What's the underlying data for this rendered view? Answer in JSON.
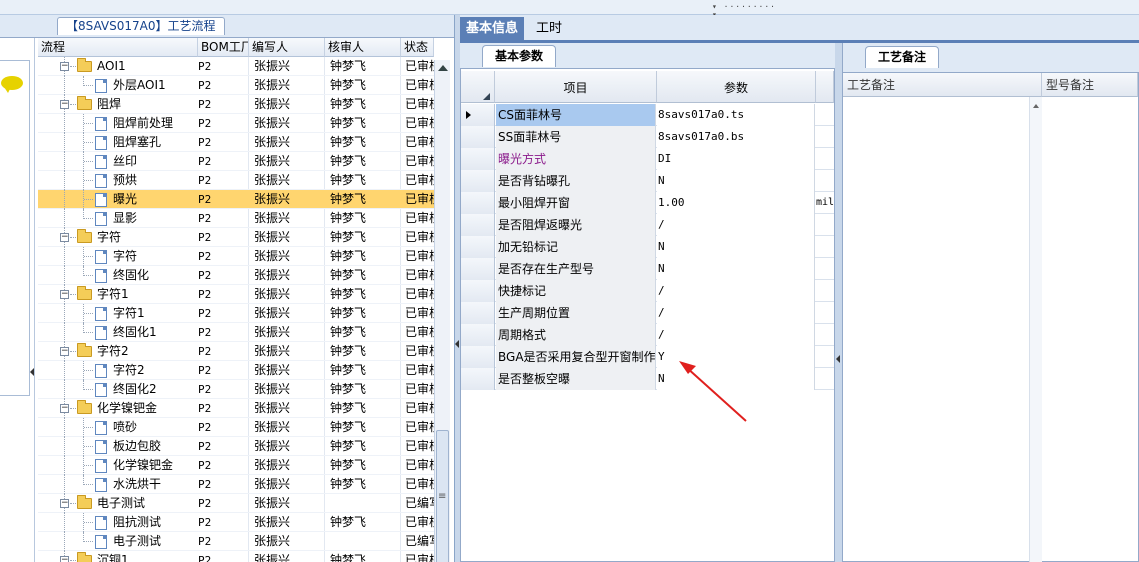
{
  "header_grip": "▾ ········· ▾",
  "left_panel": {
    "tab_title": "【8SAVS017A0】工艺流程",
    "columns": [
      "流程",
      "BOM工厂",
      "编写人",
      "核审人",
      "状态"
    ],
    "rows": [
      {
        "level": 1,
        "type": "folder",
        "name": "AOI1",
        "bom": "P2",
        "writer": "张振兴",
        "reviewer": "钟梦飞",
        "status": "已审核"
      },
      {
        "level": 2,
        "type": "doc",
        "name": "外层AOI1",
        "bom": "P2",
        "writer": "张振兴",
        "reviewer": "钟梦飞",
        "status": "已审核"
      },
      {
        "level": 1,
        "type": "folder",
        "name": "阻焊",
        "bom": "P2",
        "writer": "张振兴",
        "reviewer": "钟梦飞",
        "status": "已审核"
      },
      {
        "level": 2,
        "type": "doc",
        "name": "阻焊前处理",
        "bom": "P2",
        "writer": "张振兴",
        "reviewer": "钟梦飞",
        "status": "已审核"
      },
      {
        "level": 2,
        "type": "doc",
        "name": "阻焊塞孔",
        "bom": "P2",
        "writer": "张振兴",
        "reviewer": "钟梦飞",
        "status": "已审核"
      },
      {
        "level": 2,
        "type": "doc",
        "name": "丝印",
        "bom": "P2",
        "writer": "张振兴",
        "reviewer": "钟梦飞",
        "status": "已审核"
      },
      {
        "level": 2,
        "type": "doc",
        "name": "预烘",
        "bom": "P2",
        "writer": "张振兴",
        "reviewer": "钟梦飞",
        "status": "已审核"
      },
      {
        "level": 2,
        "type": "doc",
        "name": "曝光",
        "bom": "P2",
        "writer": "张振兴",
        "reviewer": "钟梦飞",
        "status": "已审核",
        "selected": true
      },
      {
        "level": 2,
        "type": "doc",
        "name": "显影",
        "bom": "P2",
        "writer": "张振兴",
        "reviewer": "钟梦飞",
        "status": "已审核"
      },
      {
        "level": 1,
        "type": "folder",
        "name": "字符",
        "bom": "P2",
        "writer": "张振兴",
        "reviewer": "钟梦飞",
        "status": "已审核"
      },
      {
        "level": 2,
        "type": "doc",
        "name": "字符",
        "bom": "P2",
        "writer": "张振兴",
        "reviewer": "钟梦飞",
        "status": "已审核"
      },
      {
        "level": 2,
        "type": "doc",
        "name": "终固化",
        "bom": "P2",
        "writer": "张振兴",
        "reviewer": "钟梦飞",
        "status": "已审核"
      },
      {
        "level": 1,
        "type": "folder",
        "name": "字符1",
        "bom": "P2",
        "writer": "张振兴",
        "reviewer": "钟梦飞",
        "status": "已审核"
      },
      {
        "level": 2,
        "type": "doc",
        "name": "字符1",
        "bom": "P2",
        "writer": "张振兴",
        "reviewer": "钟梦飞",
        "status": "已审核"
      },
      {
        "level": 2,
        "type": "doc",
        "name": "终固化1",
        "bom": "P2",
        "writer": "张振兴",
        "reviewer": "钟梦飞",
        "status": "已审核"
      },
      {
        "level": 1,
        "type": "folder",
        "name": "字符2",
        "bom": "P2",
        "writer": "张振兴",
        "reviewer": "钟梦飞",
        "status": "已审核"
      },
      {
        "level": 2,
        "type": "doc",
        "name": "字符2",
        "bom": "P2",
        "writer": "张振兴",
        "reviewer": "钟梦飞",
        "status": "已审核"
      },
      {
        "level": 2,
        "type": "doc",
        "name": "终固化2",
        "bom": "P2",
        "writer": "张振兴",
        "reviewer": "钟梦飞",
        "status": "已审核"
      },
      {
        "level": 1,
        "type": "folder",
        "name": "化学镍钯金",
        "bom": "P2",
        "writer": "张振兴",
        "reviewer": "钟梦飞",
        "status": "已审核"
      },
      {
        "level": 2,
        "type": "doc",
        "name": "喷砂",
        "bom": "P2",
        "writer": "张振兴",
        "reviewer": "钟梦飞",
        "status": "已审核"
      },
      {
        "level": 2,
        "type": "doc",
        "name": "板边包胶",
        "bom": "P2",
        "writer": "张振兴",
        "reviewer": "钟梦飞",
        "status": "已审核"
      },
      {
        "level": 2,
        "type": "doc",
        "name": "化学镍钯金",
        "bom": "P2",
        "writer": "张振兴",
        "reviewer": "钟梦飞",
        "status": "已审核"
      },
      {
        "level": 2,
        "type": "doc",
        "name": "水洗烘干",
        "bom": "P2",
        "writer": "张振兴",
        "reviewer": "钟梦飞",
        "status": "已审核"
      },
      {
        "level": 1,
        "type": "folder",
        "name": "电子测试",
        "bom": "P2",
        "writer": "张振兴",
        "reviewer": "",
        "status": "已编写"
      },
      {
        "level": 2,
        "type": "doc",
        "name": "阻抗测试",
        "bom": "P2",
        "writer": "张振兴",
        "reviewer": "钟梦飞",
        "status": "已审核"
      },
      {
        "level": 2,
        "type": "doc",
        "name": "电子测试",
        "bom": "P2",
        "writer": "张振兴",
        "reviewer": "",
        "status": "已编写"
      },
      {
        "level": 1,
        "type": "folder",
        "name": "沉铜1",
        "bom": "P2",
        "writer": "张振兴",
        "reviewer": "钟梦飞",
        "status": "已审核"
      }
    ]
  },
  "main_tabs": [
    "基本信息",
    "工时"
  ],
  "basic_params": {
    "subtab": "基本参数",
    "columns": [
      "项目",
      "参数"
    ],
    "rows": [
      {
        "key": "CS面菲林号",
        "value": "8savs017a0.ts",
        "unit": "",
        "current": true,
        "selected": true
      },
      {
        "key": "SS面菲林号",
        "value": "8savs017a0.bs",
        "unit": ""
      },
      {
        "key": "曝光方式",
        "value": "DI",
        "unit": "",
        "highlight": "#8b1a8b"
      },
      {
        "key": "是否背钻曝孔",
        "value": "N",
        "unit": ""
      },
      {
        "key": "最小阻焊开窗",
        "value": "1.00",
        "unit": "mil"
      },
      {
        "key": "是否阻焊返曝光",
        "value": "/",
        "unit": ""
      },
      {
        "key": "加无铅标记",
        "value": "N",
        "unit": ""
      },
      {
        "key": "是否存在生产型号",
        "value": "N",
        "unit": ""
      },
      {
        "key": "快捷标记",
        "value": "/",
        "unit": ""
      },
      {
        "key": "生产周期位置",
        "value": "/",
        "unit": ""
      },
      {
        "key": "周期格式",
        "value": "/",
        "unit": ""
      },
      {
        "key": "BGA是否采用复合型开窗制作",
        "value": "Y",
        "unit": ""
      },
      {
        "key": "是否整板空曝",
        "value": "N",
        "unit": ""
      }
    ]
  },
  "process_notes": {
    "subtab": "工艺备注",
    "columns": [
      "工艺备注",
      "型号备注"
    ]
  },
  "annotation_arrow_color": "#e0201e"
}
